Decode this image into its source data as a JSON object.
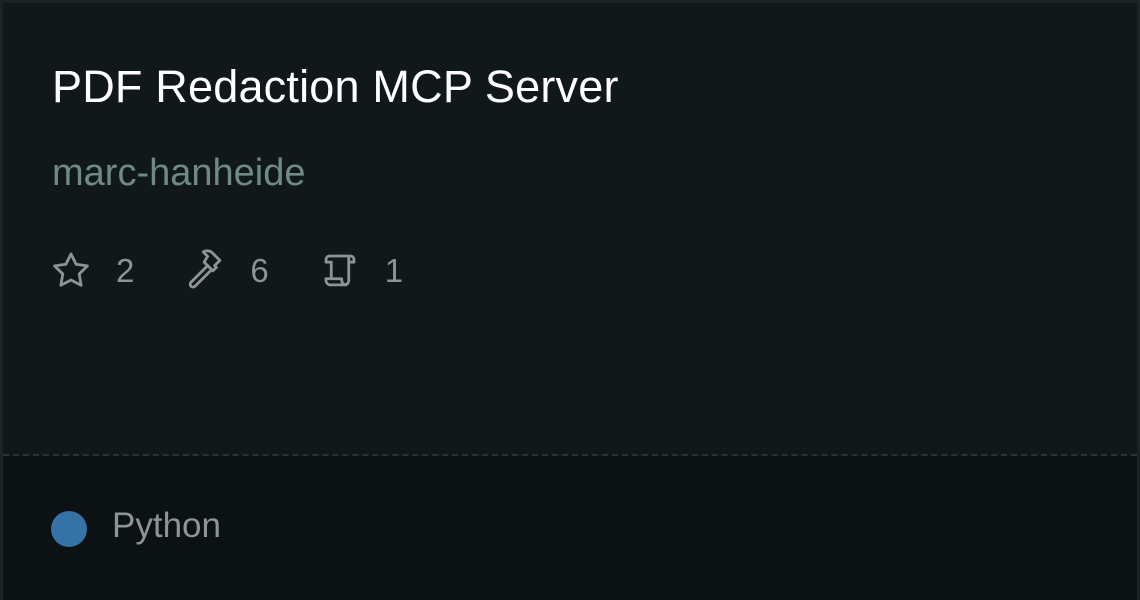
{
  "card": {
    "title": "PDF Redaction MCP Server",
    "author": "marc-hanheide",
    "stats": [
      {
        "icon": "star-icon",
        "value": "2"
      },
      {
        "icon": "hammer-icon",
        "value": "6"
      },
      {
        "icon": "scroll-icon",
        "value": "1"
      }
    ],
    "language": {
      "name": "Python",
      "color": "#3572a5"
    }
  }
}
